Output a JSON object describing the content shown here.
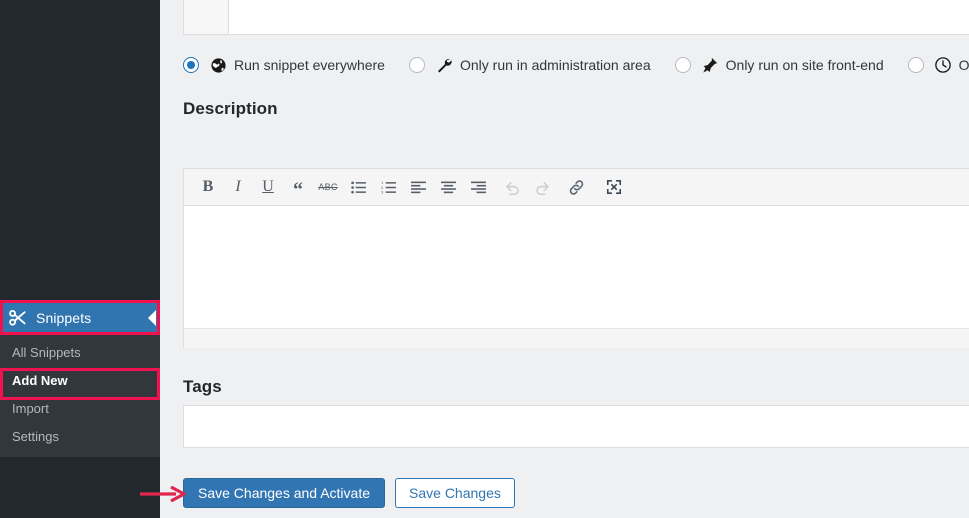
{
  "sidebar": {
    "menu": {
      "label": "Snippets",
      "icon": "scissors-icon",
      "collapse_icon": "triangle-left-icon",
      "active_color": "#3175b0",
      "highlight_color": "#f0114e"
    },
    "submenu": [
      {
        "label": "All Snippets",
        "current": false
      },
      {
        "label": "Add New",
        "current": true
      },
      {
        "label": "Import",
        "current": false
      },
      {
        "label": "Settings",
        "current": false
      }
    ]
  },
  "main": {
    "scope": {
      "options": [
        {
          "label": "Run snippet everywhere",
          "icon": "globe-icon",
          "checked": true
        },
        {
          "label": "Only run in administration area",
          "icon": "wrench-icon",
          "checked": false
        },
        {
          "label": "Only run on site front-end",
          "icon": "pin-icon",
          "checked": false
        },
        {
          "label": "Only run onc",
          "icon": "clock-icon",
          "checked": false
        }
      ]
    },
    "description": {
      "title": "Description",
      "value": "",
      "toolbar": [
        {
          "name": "bold-icon",
          "glyph": "B",
          "disabled": false
        },
        {
          "name": "italic-icon",
          "glyph": "I",
          "disabled": false
        },
        {
          "name": "underline-icon",
          "glyph": "U",
          "disabled": false
        },
        {
          "name": "blockquote-icon",
          "glyph": "“",
          "disabled": false
        },
        {
          "name": "strikethrough-icon",
          "glyph": "ABC",
          "disabled": false
        },
        {
          "name": "bulleted-list-icon",
          "glyph": "",
          "disabled": false
        },
        {
          "name": "numbered-list-icon",
          "glyph": "",
          "disabled": false
        },
        {
          "name": "align-left-icon",
          "glyph": "",
          "disabled": false
        },
        {
          "name": "align-center-icon",
          "glyph": "",
          "disabled": false
        },
        {
          "name": "align-right-icon",
          "glyph": "",
          "disabled": false
        },
        {
          "name": "undo-icon",
          "glyph": "",
          "disabled": true
        },
        {
          "name": "redo-icon",
          "glyph": "",
          "disabled": true
        },
        {
          "name": "link-icon",
          "glyph": "",
          "disabled": false
        },
        {
          "name": "fullscreen-icon",
          "glyph": "",
          "disabled": false
        }
      ]
    },
    "tags": {
      "title": "Tags",
      "value": "",
      "placeholder": ""
    },
    "buttons": {
      "primary": "Save Changes and Activate",
      "secondary": "Save Changes",
      "primary_color": "#3176b2"
    },
    "annotation": {
      "arrow_color": "#e0264f"
    }
  }
}
